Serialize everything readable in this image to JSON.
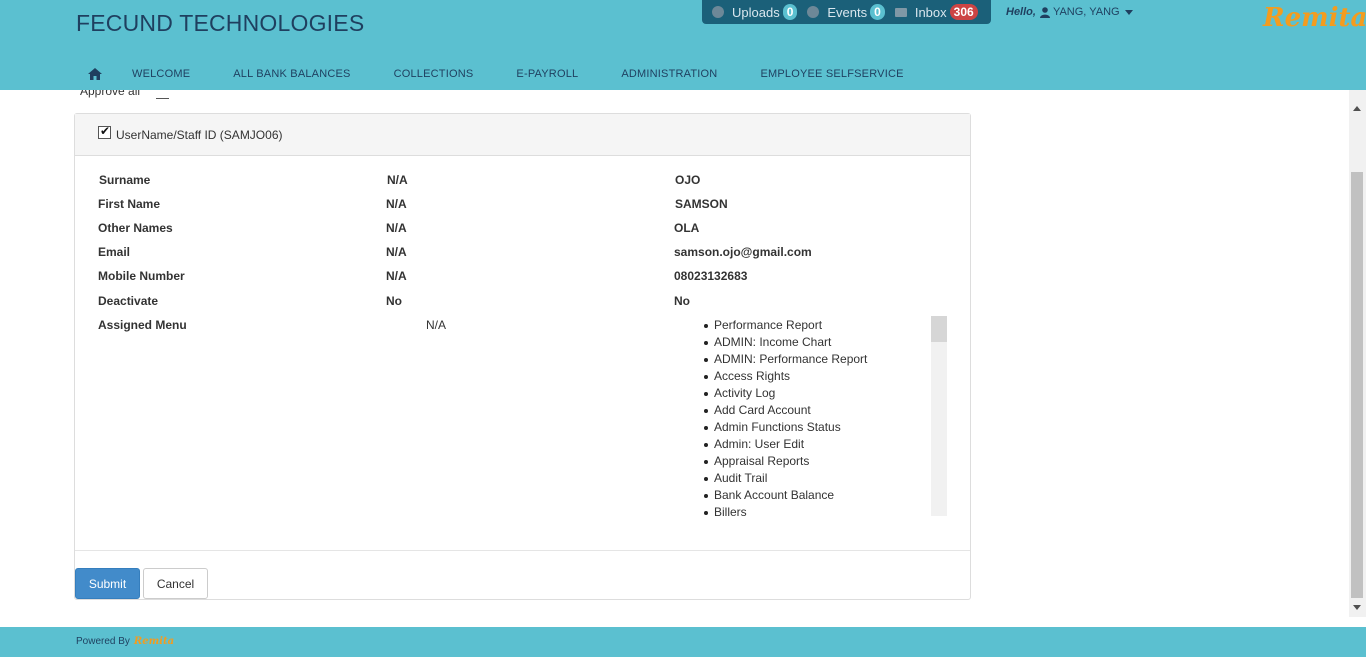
{
  "header": {
    "brand": "FECUND TECHNOLOGIES",
    "uploads_label": "Uploads",
    "uploads_count": "0",
    "events_label": "Events",
    "events_count": "0",
    "inbox_label": "Inbox",
    "inbox_count": "306",
    "hello": "Hello,",
    "user_name": "YANG, YANG",
    "logo_text": "Remita"
  },
  "nav": {
    "items": [
      "WELCOME",
      "ALL BANK BALANCES",
      "COLLECTIONS",
      "E-PAYROLL",
      "ADMINISTRATION",
      "EMPLOYEE SELFSERVICE"
    ]
  },
  "content": {
    "approve_all": "Approve all"
  },
  "panel": {
    "heading": "UserName/Staff ID (SAMJO06)",
    "rows": [
      {
        "label": "Surname",
        "old": "N/A",
        "new": "OJO"
      },
      {
        "label": "First Name",
        "old": "N/A",
        "new": "SAMSON"
      },
      {
        "label": "Other Names",
        "old": "N/A",
        "new": "OLA"
      },
      {
        "label": "Email",
        "old": "N/A",
        "new": "samson.ojo@gmail.com"
      },
      {
        "label": "Mobile Number",
        "old": "N/A",
        "new": "08023132683"
      },
      {
        "label": "Deactivate",
        "old": "No",
        "new": "No"
      }
    ],
    "assigned_menu_label": "Assigned Menu",
    "assigned_menu_old": "N/A",
    "assigned_menu_items": [
      "Performance Report",
      "ADMIN: Income Chart",
      "ADMIN: Performance Report",
      "Access Rights",
      "Activity Log",
      "Add Card Account",
      "Admin Functions Status",
      "Admin: User Edit",
      "Appraisal Reports",
      "Audit Trail",
      "Bank Account Balance",
      "Billers"
    ],
    "submit_label": "Submit",
    "cancel_label": "Cancel"
  },
  "footer": {
    "powered_by": "Powered By",
    "logo_text": "Remita"
  },
  "colors": {
    "header_bg": "#5bc0d0",
    "notif_bg": "#1b6079",
    "brand_text": "#1f3f5f",
    "submit_bg": "#428bca",
    "logo_orange": "#f39c1f",
    "inbox_badge": "#cc4444"
  }
}
